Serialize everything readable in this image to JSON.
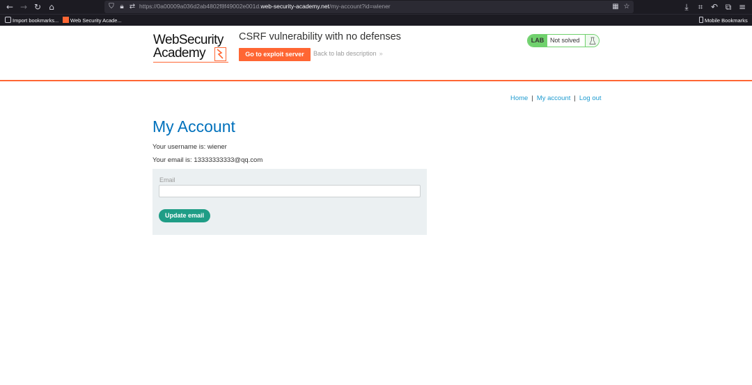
{
  "browser": {
    "url_prefix": "https://0a00009a036d2ab4802f8f49002e001d.",
    "url_host": "web-security-academy.net",
    "url_path": "/my-account?id=wiener",
    "bookmarks": [
      {
        "label": "Import bookmarks..."
      },
      {
        "label": "Web Security Acade..."
      }
    ],
    "mobile_bookmarks": "Mobile Bookmarks"
  },
  "header": {
    "logo_line1": "WebSecurity",
    "logo_line2": "Academy",
    "lab_title": "CSRF vulnerability with no defenses",
    "exploit_button": "Go to exploit server",
    "back_link": "Back to lab description",
    "back_chevron": "»",
    "lab_badge": "LAB",
    "lab_status": "Not solved"
  },
  "nav": {
    "home": "Home",
    "my_account": "My account",
    "log_out": "Log out",
    "separator": "|"
  },
  "main": {
    "title": "My Account",
    "username_line": "Your username is: wiener",
    "email_line": "Your email is: 13333333333@qq.com",
    "email_label": "Email",
    "email_value": "",
    "update_button": "Update email"
  },
  "colors": {
    "accent_orange": "#ff6633",
    "lab_green": "#70d16d",
    "link_blue": "#1f9bd0",
    "title_blue": "#0071bc",
    "button_teal": "#1f9d86",
    "form_bg": "#ebf0f2"
  },
  "icons": [
    "back-arrow-icon",
    "forward-arrow-icon",
    "reload-icon",
    "home-icon",
    "shield-icon",
    "lock-icon",
    "permissions-icon",
    "qr-code-icon",
    "bookmark-star-icon",
    "download-icon",
    "crop-icon",
    "undo-icon",
    "extensions-icon",
    "menu-icon",
    "flask-icon"
  ]
}
